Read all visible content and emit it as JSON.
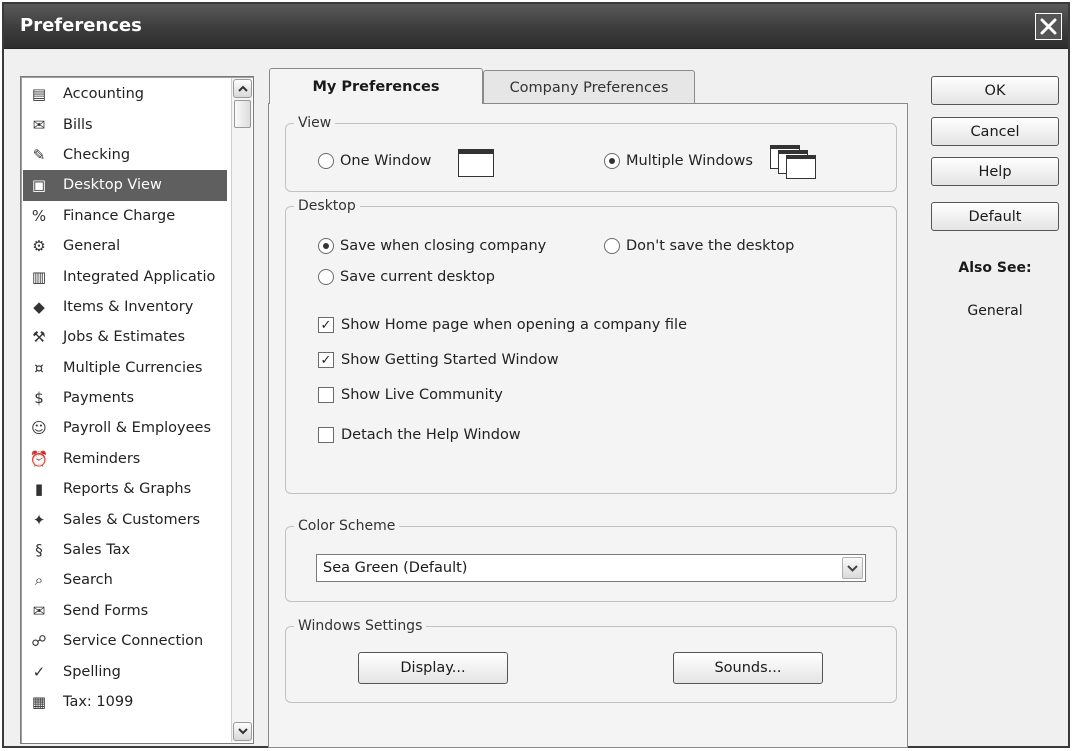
{
  "window": {
    "title": "Preferences"
  },
  "sidebar": {
    "items": [
      {
        "label": "Accounting",
        "icon": "ledger-icon"
      },
      {
        "label": "Bills",
        "icon": "bills-icon"
      },
      {
        "label": "Checking",
        "icon": "checkbook-icon"
      },
      {
        "label": "Desktop View",
        "icon": "desktop-view-icon",
        "selected": true
      },
      {
        "label": "Finance Charge",
        "icon": "percent-icon"
      },
      {
        "label": "General",
        "icon": "general-icon"
      },
      {
        "label": "Integrated Applicatio",
        "icon": "integrated-apps-icon"
      },
      {
        "label": "Items & Inventory",
        "icon": "inventory-icon"
      },
      {
        "label": "Jobs & Estimates",
        "icon": "jobs-icon"
      },
      {
        "label": "Multiple Currencies",
        "icon": "currencies-icon"
      },
      {
        "label": "Payments",
        "icon": "payments-icon"
      },
      {
        "label": "Payroll & Employees",
        "icon": "payroll-icon"
      },
      {
        "label": "Reminders",
        "icon": "reminders-icon"
      },
      {
        "label": "Reports & Graphs",
        "icon": "reports-icon"
      },
      {
        "label": "Sales & Customers",
        "icon": "sales-icon"
      },
      {
        "label": "Sales Tax",
        "icon": "sales-tax-icon"
      },
      {
        "label": "Search",
        "icon": "search-icon"
      },
      {
        "label": "Send Forms",
        "icon": "send-forms-icon"
      },
      {
        "label": "Service Connection",
        "icon": "service-connection-icon"
      },
      {
        "label": "Spelling",
        "icon": "spelling-icon"
      },
      {
        "label": "Tax: 1099",
        "icon": "tax-form-icon"
      }
    ]
  },
  "tabs": [
    {
      "label": "My Preferences",
      "active": true
    },
    {
      "label": "Company Preferences",
      "active": false
    }
  ],
  "view": {
    "legend": "View",
    "one_window": "One Window",
    "multiple_windows": "Multiple Windows",
    "selected": "multiple_windows"
  },
  "desktop": {
    "legend": "Desktop",
    "save_when_closing": "Save when closing company",
    "dont_save": "Don't save the desktop",
    "save_current": "Save current desktop",
    "selected": "save_when_closing",
    "checks": [
      {
        "label": "Show Home page when opening a company file",
        "checked": true
      },
      {
        "label": "Show Getting Started Window",
        "checked": true
      },
      {
        "label": "Show Live Community",
        "checked": false
      },
      {
        "label": "Detach the Help Window",
        "checked": false
      }
    ]
  },
  "color_scheme": {
    "legend": "Color Scheme",
    "value": "Sea Green (Default)"
  },
  "windows_settings": {
    "legend": "Windows Settings",
    "display": "Display...",
    "sounds": "Sounds..."
  },
  "buttons": {
    "ok": "OK",
    "cancel": "Cancel",
    "help": "Help",
    "default": "Default"
  },
  "also_see": {
    "heading": "Also See:",
    "link": "General"
  },
  "colors": {
    "selected_bg": "#5f5f5f",
    "titlebar": "#3c3c3c",
    "panel_bg": "#f4f4f4"
  }
}
